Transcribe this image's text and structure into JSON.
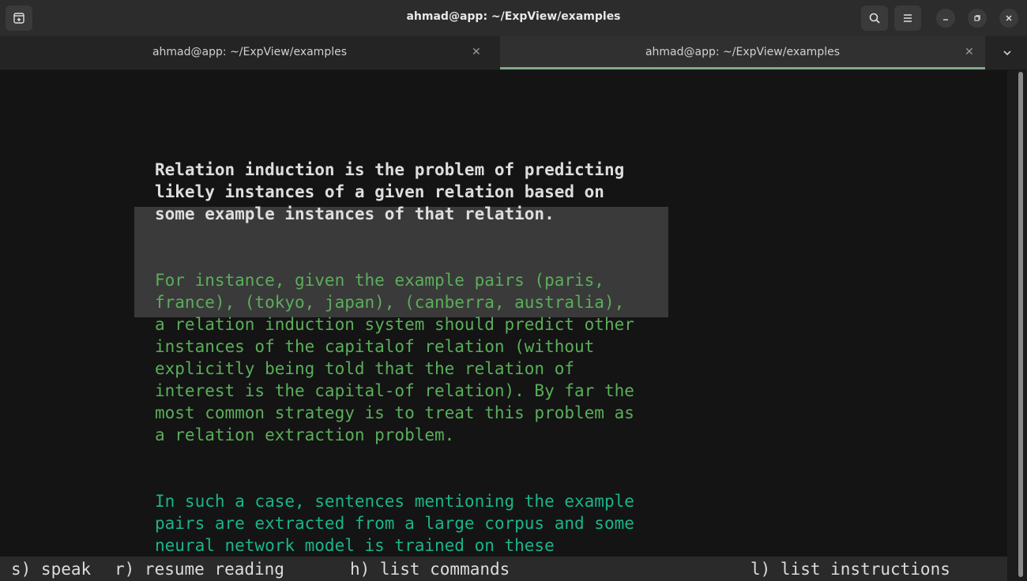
{
  "window": {
    "title": "ahmad@app: ~/ExpView/examples"
  },
  "tabs": [
    {
      "label": "ahmad@app: ~/ExpView/examples",
      "close_icon": "close-icon"
    },
    {
      "label": "ahmad@app: ~/ExpView/examples",
      "close_icon": "close-icon"
    }
  ],
  "colors": {
    "heading_text": "#dedede",
    "body_green": "#5aae5a",
    "body_teal": "#1ab48a",
    "tab_accent": "#7fa88a"
  },
  "content": {
    "heading_lines": [
      "Relation induction is the problem of predicting",
      "likely instances of a given relation based on",
      "some example instances of that relation."
    ],
    "paragraph1_lines": [
      "For instance, given the example pairs (paris,",
      "france), (tokyo, japan), (canberra, australia),",
      "a relation induction system should predict other",
      "instances of the capitalof relation (without",
      "explicitly being told that the relation of",
      "interest is the capital-of relation). By far the",
      "most common strategy is to treat this problem as",
      "a relation extraction problem."
    ],
    "paragraph2_lines": [
      "In such a case, sentences mentioning the example",
      "pairs are extracted from a large corpus and some",
      "neural network model is trained on these"
    ]
  },
  "statusbar": {
    "speak": "s) speak",
    "resume": "r) resume reading",
    "commands": "h) list commands",
    "instructions": "l) list instructions"
  }
}
